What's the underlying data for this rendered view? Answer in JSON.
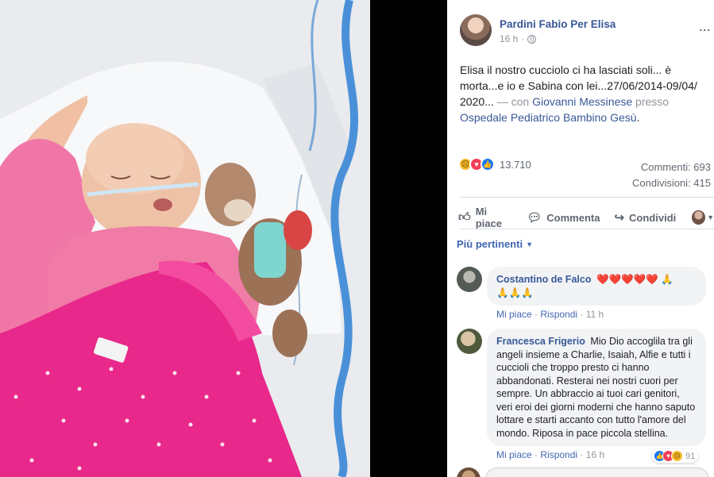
{
  "photo": {
    "alt_icon": "photo-of-child-in-hospital-bed"
  },
  "post": {
    "author": "Pardini Fabio Per Elisa",
    "time": "16 h",
    "privacy_icon": "globe-icon",
    "text_main": "Elisa il nostro cucciolo ci ha lasciati soli... è morta...e io e Sabina con lei...27/06/2014-09/04/ 2020...",
    "text_with": "— con",
    "tag_person": "Giovanni Messinese",
    "text_at": "presso",
    "tag_place": "Ospedale Pediatrico Bambino Gesù",
    "text_end": ".",
    "reaction_count": "13.710",
    "comments_count": "Commenti: 693",
    "shares_count": "Condivisioni: 415",
    "more": "..."
  },
  "actions": {
    "like": "Mi piace",
    "comment": "Commenta",
    "share": "Condividi"
  },
  "sort": {
    "label": "Più pertinenti"
  },
  "comments": [
    {
      "name": "Costantino de Falco",
      "text": "❤️❤️❤️❤️❤️ 🙏\n🙏🙏🙏",
      "like": "Mi piace",
      "reply": "Rispondi",
      "time": "11 h"
    },
    {
      "name": "Francesca Frigerio",
      "text": "Mio Dio accoglila tra gli angeli insieme a Charlie, Isaiah, Alfie e tutti i cuccioli che troppo presto ci hanno abbandonati. Resterai nei nostri cuori per sempre. Un abbraccio ai tuoi cari genitori, veri eroi dei giorni moderni che hanno saputo lottare e starti accanto con tutto l'amore del mondo. Riposa in pace piccola stellina.",
      "like": "Mi piace",
      "reply": "Rispondi",
      "time": "16 h",
      "reactions": "91"
    }
  ],
  "colors": {
    "link": "#385898",
    "accent": "#4267b2",
    "muted": "#90949c",
    "bubble": "#f2f3f5"
  }
}
